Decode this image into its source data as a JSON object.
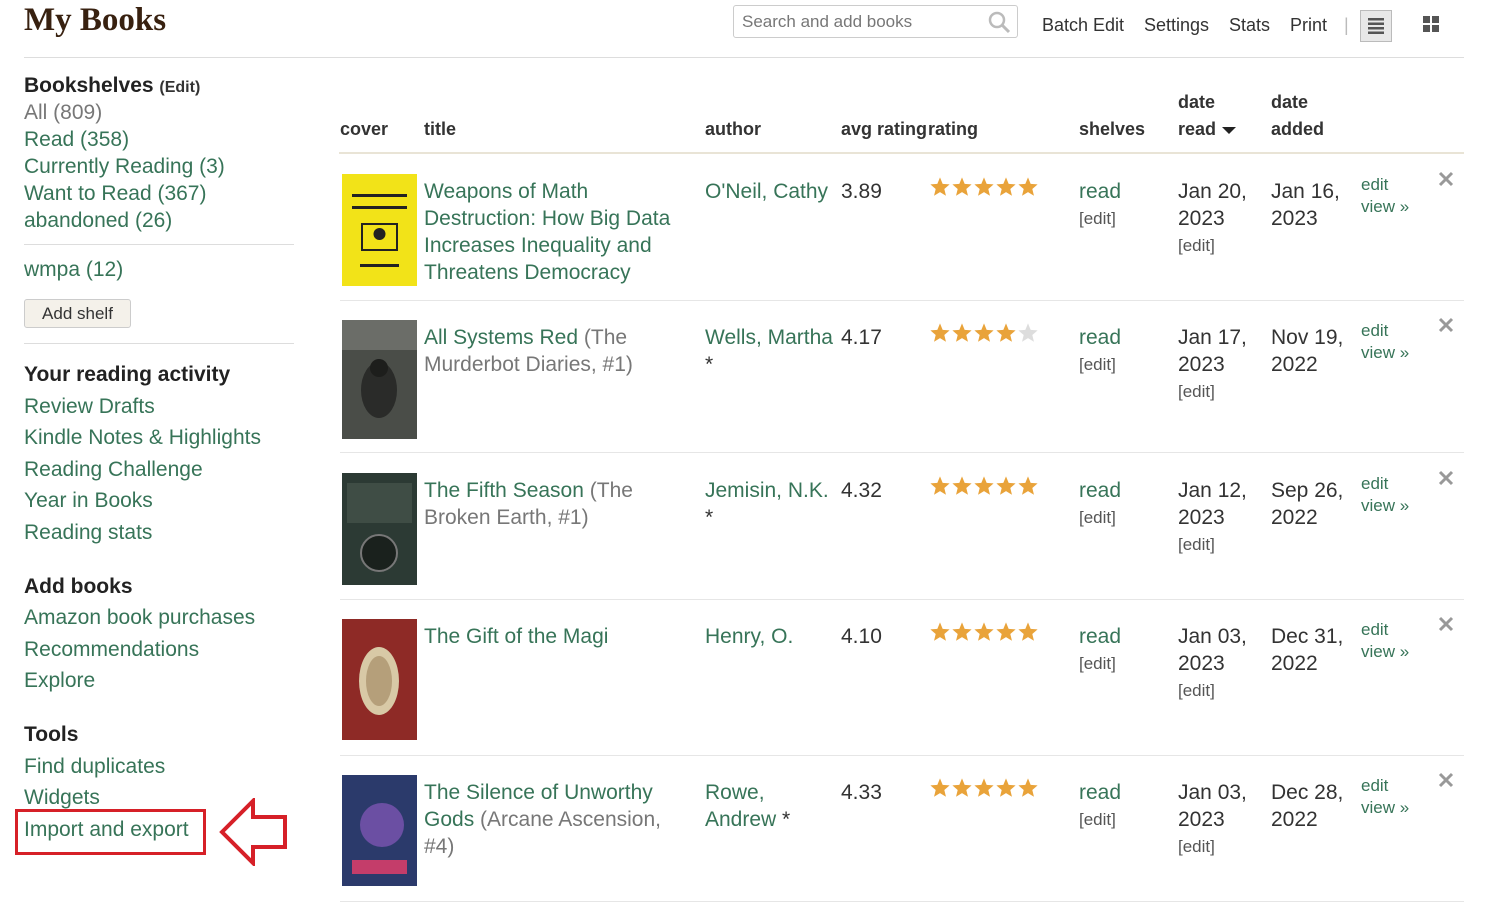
{
  "header": {
    "title": "My Books",
    "search_placeholder": "Search and add books",
    "nav": [
      "Batch Edit",
      "Settings",
      "Stats",
      "Print"
    ],
    "separator": "|"
  },
  "sidebar": {
    "bookshelves_heading": "Bookshelves",
    "bookshelves_edit": "(Edit)",
    "shelves": [
      "All (809)",
      "Read (358)",
      "Currently Reading (3)",
      "Want to Read (367)",
      "abandoned (26)"
    ],
    "custom_shelves": [
      "wmpa (12)"
    ],
    "add_shelf": "Add shelf",
    "activity_heading": "Your reading activity",
    "activity": [
      "Review Drafts",
      "Kindle Notes & Highlights",
      "Reading Challenge",
      "Year in Books",
      "Reading stats"
    ],
    "add_heading": "Add books",
    "add": [
      "Amazon book purchases",
      "Recommendations",
      "Explore"
    ],
    "tools_heading": "Tools",
    "tools": [
      "Find duplicates",
      "Widgets",
      "Import and export"
    ]
  },
  "table": {
    "headers": {
      "cover": "cover",
      "title": "title",
      "author": "author",
      "avg_rating": "avg rating",
      "rating": "rating",
      "shelves": "shelves",
      "date_read_1": "date",
      "date_read_2": "read",
      "date_added_1": "date",
      "date_added_2": "added"
    },
    "shelf_edit": "[edit]",
    "date_edit": "[edit]",
    "edit_link": "edit",
    "view_link": "view »",
    "remove_symbol": "✕",
    "rows": [
      {
        "title": "Weapons of Math Destruction: How Big Data Increases Inequality and Threatens Democracy",
        "series": "",
        "author": "O'Neil, Cathy",
        "author_star": "",
        "avg": "3.89",
        "rating": 5,
        "shelf": "read",
        "date_read": "Jan 20, 2023",
        "date_added": "Jan 16, 2023",
        "cover_color": "#f2e318"
      },
      {
        "title": "All Systems Red",
        "series": "(The Murderbot Diaries, #1)",
        "author": "Wells, Martha",
        "author_star": "*",
        "avg": "4.17",
        "rating": 4,
        "shelf": "read",
        "date_read": "Jan 17, 2023",
        "date_added": "Nov 19, 2022",
        "cover_color": "#4a4d48"
      },
      {
        "title": "The Fifth Season",
        "series": "(The Broken Earth, #1)",
        "author": "Jemisin, N.K.",
        "author_star": "*",
        "avg": "4.32",
        "rating": 5,
        "shelf": "read",
        "date_read": "Jan 12, 2023",
        "date_added": "Sep 26, 2022",
        "cover_color": "#2c3a34"
      },
      {
        "title": "The Gift of the Magi",
        "series": "",
        "author": "Henry, O.",
        "author_star": "",
        "avg": "4.10",
        "rating": 5,
        "shelf": "read",
        "date_read": "Jan 03, 2023",
        "date_added": "Dec 31, 2022",
        "cover_color": "#8e2a26"
      },
      {
        "title": "The Silence of Unworthy Gods",
        "series": "(Arcane Ascension, #4)",
        "author": "Rowe, Andrew",
        "author_star": "*",
        "avg": "4.33",
        "rating": 5,
        "shelf": "read",
        "date_read": "Jan 03, 2023",
        "date_added": "Dec 28, 2022",
        "cover_color": "#2b3a6b"
      }
    ]
  },
  "colors": {
    "link": "#377458",
    "star": "#e9a33a",
    "star_empty": "#ddd",
    "highlight": "#d62028"
  }
}
